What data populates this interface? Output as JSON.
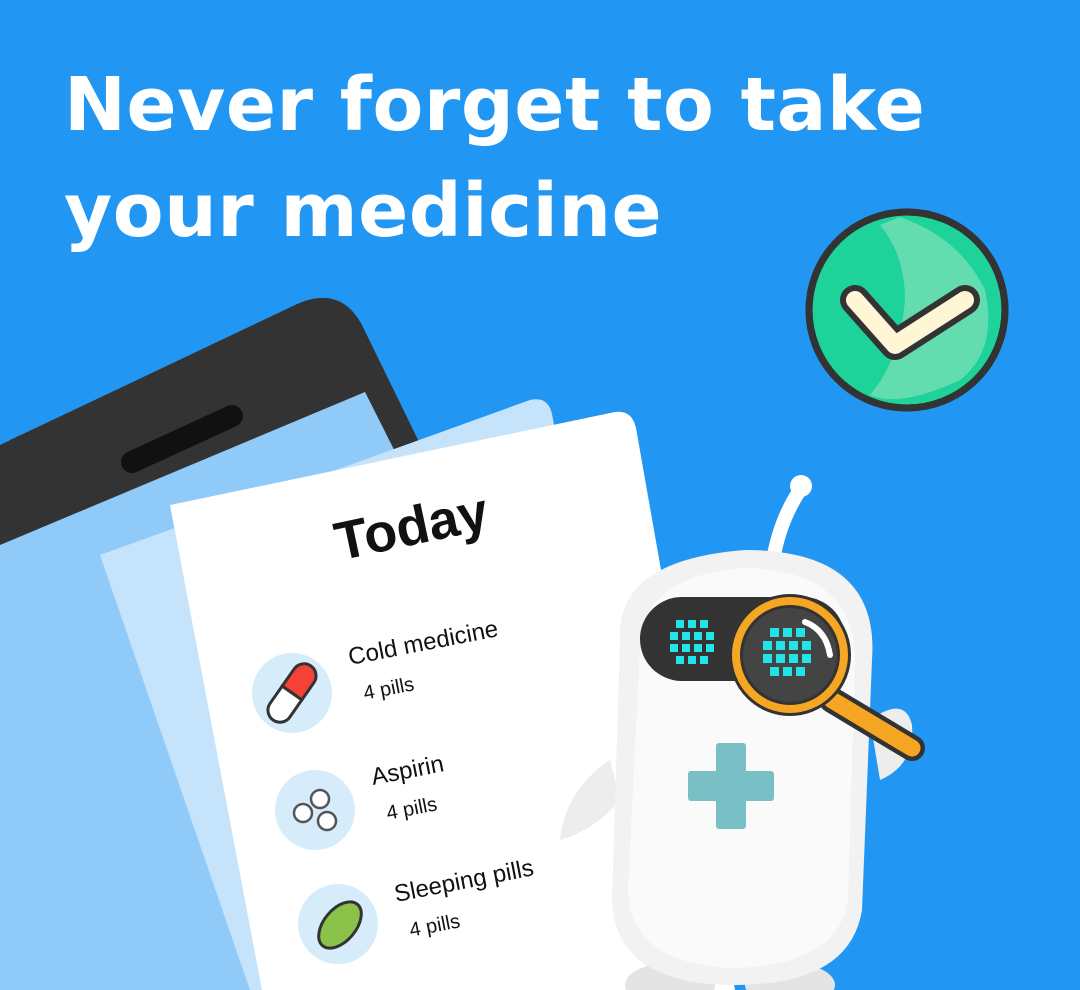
{
  "headline": {
    "line1": "Never forget to take",
    "line2": "your medicine"
  },
  "card": {
    "title": "Today",
    "items": [
      {
        "name": "Cold medicine",
        "dose": "4 pills",
        "icon": "capsule-icon"
      },
      {
        "name": "Aspirin",
        "dose": "4 pills",
        "icon": "tablets-icon"
      },
      {
        "name": "Sleeping pills",
        "dose": "4 pills",
        "icon": "oval-pill-icon"
      }
    ]
  },
  "colors": {
    "background": "#2196F3",
    "phone": "#333333",
    "check_badge": "#1DD39A",
    "magnifier": "#F5A623",
    "robot_eye_pixels": "#22E3E8",
    "robot_cross": "#79BFC6"
  }
}
